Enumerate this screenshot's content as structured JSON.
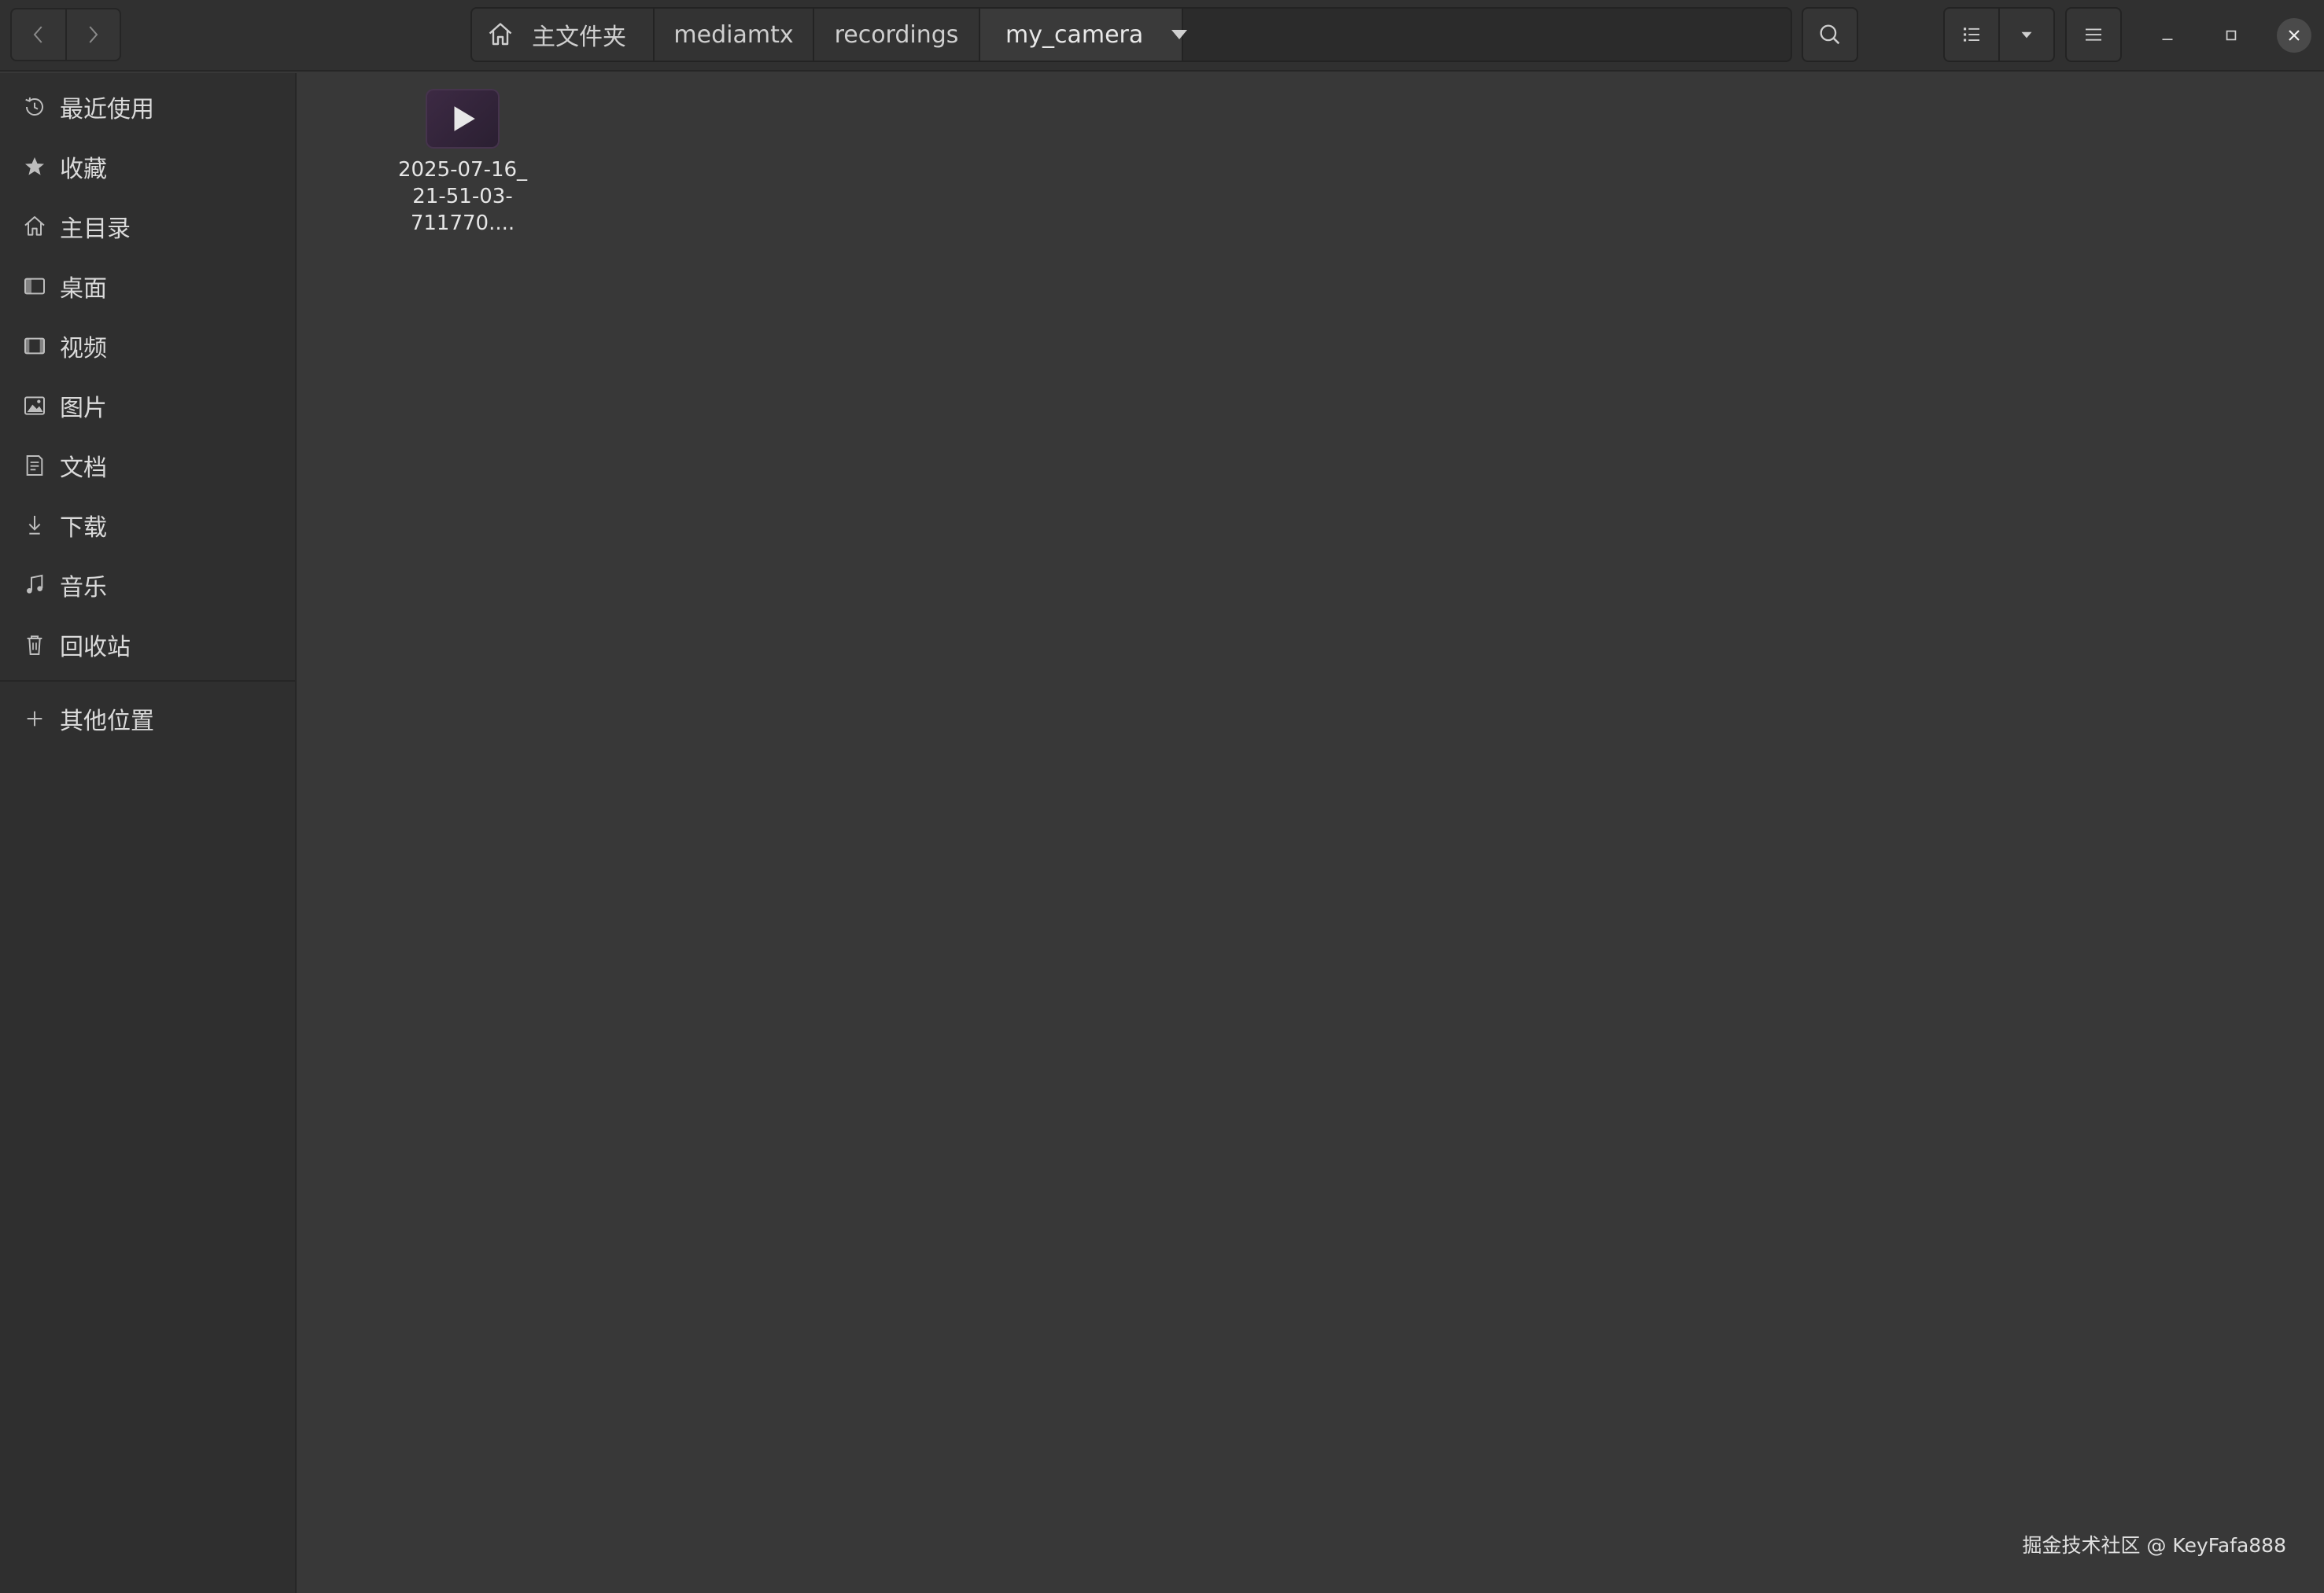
{
  "pathbar": {
    "crumbs": [
      "主文件夹",
      "mediamtx",
      "recordings",
      "my_camera"
    ]
  },
  "sidebar": {
    "items": [
      {
        "label": "最近使用",
        "icon": "clock-icon"
      },
      {
        "label": "收藏",
        "icon": "star-icon"
      },
      {
        "label": "主目录",
        "icon": "home-icon"
      },
      {
        "label": "桌面",
        "icon": "desktop-icon"
      },
      {
        "label": "视频",
        "icon": "film-icon"
      },
      {
        "label": "图片",
        "icon": "image-icon"
      },
      {
        "label": "文档",
        "icon": "document-icon"
      },
      {
        "label": "下载",
        "icon": "download-icon"
      },
      {
        "label": "音乐",
        "icon": "music-icon"
      },
      {
        "label": "回收站",
        "icon": "trash-icon"
      }
    ],
    "other_locations": {
      "label": "其他位置",
      "icon": "plus-icon"
    }
  },
  "files": [
    {
      "name_lines": [
        "2025-07-16_",
        "21-51-03-",
        "711770...."
      ],
      "icon": "video-play-icon"
    }
  ],
  "watermark": "掘金技术社区 @ KeyFafa888",
  "colors": {
    "window_bg": "#383838",
    "sidebar_bg": "#2f2f2f",
    "headerbar_bg": "#303030",
    "text": "#dcdcdc",
    "thumb_accent": "#3d2a44"
  }
}
